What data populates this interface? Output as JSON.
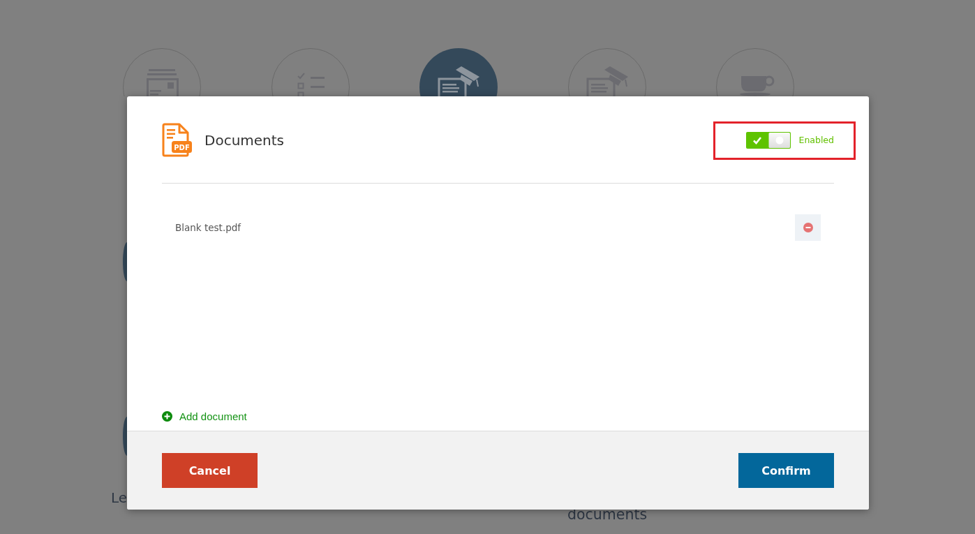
{
  "background": {
    "steps": [
      {
        "selected": false
      },
      {
        "selected": false
      },
      {
        "selected": true
      },
      {
        "selected": false
      },
      {
        "selected": false
      }
    ],
    "labels": [
      "Le",
      "documents"
    ]
  },
  "dialog": {
    "icon_label": "PDF",
    "title": "Documents",
    "toggle": {
      "on": true,
      "label": "Enabled",
      "highlighted": true
    },
    "documents": [
      {
        "name": "Blank test.pdf"
      }
    ],
    "add_label": "Add document",
    "buttons": [
      {
        "kind": "cancel",
        "label": "Cancel"
      },
      {
        "kind": "confirm",
        "label": "Confirm"
      }
    ]
  }
}
